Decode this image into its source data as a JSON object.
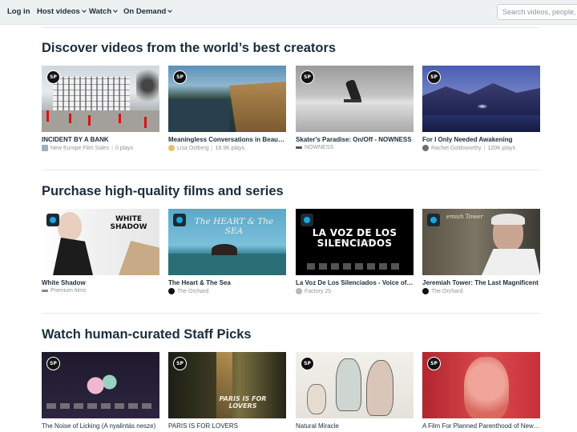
{
  "nav": {
    "login": "Log in",
    "host_videos": "Host videos",
    "watch": "Watch",
    "on_demand": "On Demand",
    "search_placeholder": "Search videos, people, and more"
  },
  "sections": [
    {
      "title": "Discover videos from the world’s best creators",
      "cards": [
        {
          "title": "INCIDENT BY A BANK",
          "author": "New Europe Film Sales",
          "plays": "0 plays",
          "badge": "SP"
        },
        {
          "title": "Meaningless Conversations in Beautiful Places",
          "author": "Lisa Ostberg",
          "plays": "18.9K plays",
          "badge": "SP"
        },
        {
          "title": "Skater's Paradise: On/Off - NOWNESS",
          "author": "NOWNESS",
          "plays": "",
          "badge": "SP"
        },
        {
          "title": "For I Only Needed Awakening",
          "author": "Rachel Goldsworthy",
          "plays": "120K plays",
          "badge": "SP"
        }
      ]
    },
    {
      "title": "Purchase high-quality films and series",
      "cards": [
        {
          "title": "White Shadow",
          "author": "Premium films",
          "overlay": "WHITE SHADOW"
        },
        {
          "title": "The Heart & The Sea",
          "author": "The Orchard",
          "overlay": "The HEART & The SEA"
        },
        {
          "title": "La Voz De Los Silenciados - Voice of the Voiceless",
          "author": "Factory 25",
          "overlay": "LA VOZ DE LOS SILENCIADOS",
          "overlay_sub": "THE VOICE OF THE VOICELESS"
        },
        {
          "title": "Jeremiah Tower: The Last Magnificent",
          "author": "The Orchard",
          "overlay": "emiah Tower"
        }
      ]
    },
    {
      "title": "Watch human-curated Staff Picks",
      "cards": [
        {
          "title": "The Noise of Licking (A nyalintás nesze)",
          "badge": "SP"
        },
        {
          "title": "PARIS IS FOR LOVERS",
          "badge": "SP",
          "overlay": "PARIS IS FOR LOVERS"
        },
        {
          "title": "Natural Miracle",
          "badge": "SP"
        },
        {
          "title": "A Film For Planned Parenthood of New York",
          "badge": "SP"
        }
      ]
    }
  ],
  "colors": {
    "topbar_bg": "#eef1f2",
    "text": "#1a2e3b",
    "meta": "#8a969c",
    "on_demand_accent": "#17a6e0"
  }
}
